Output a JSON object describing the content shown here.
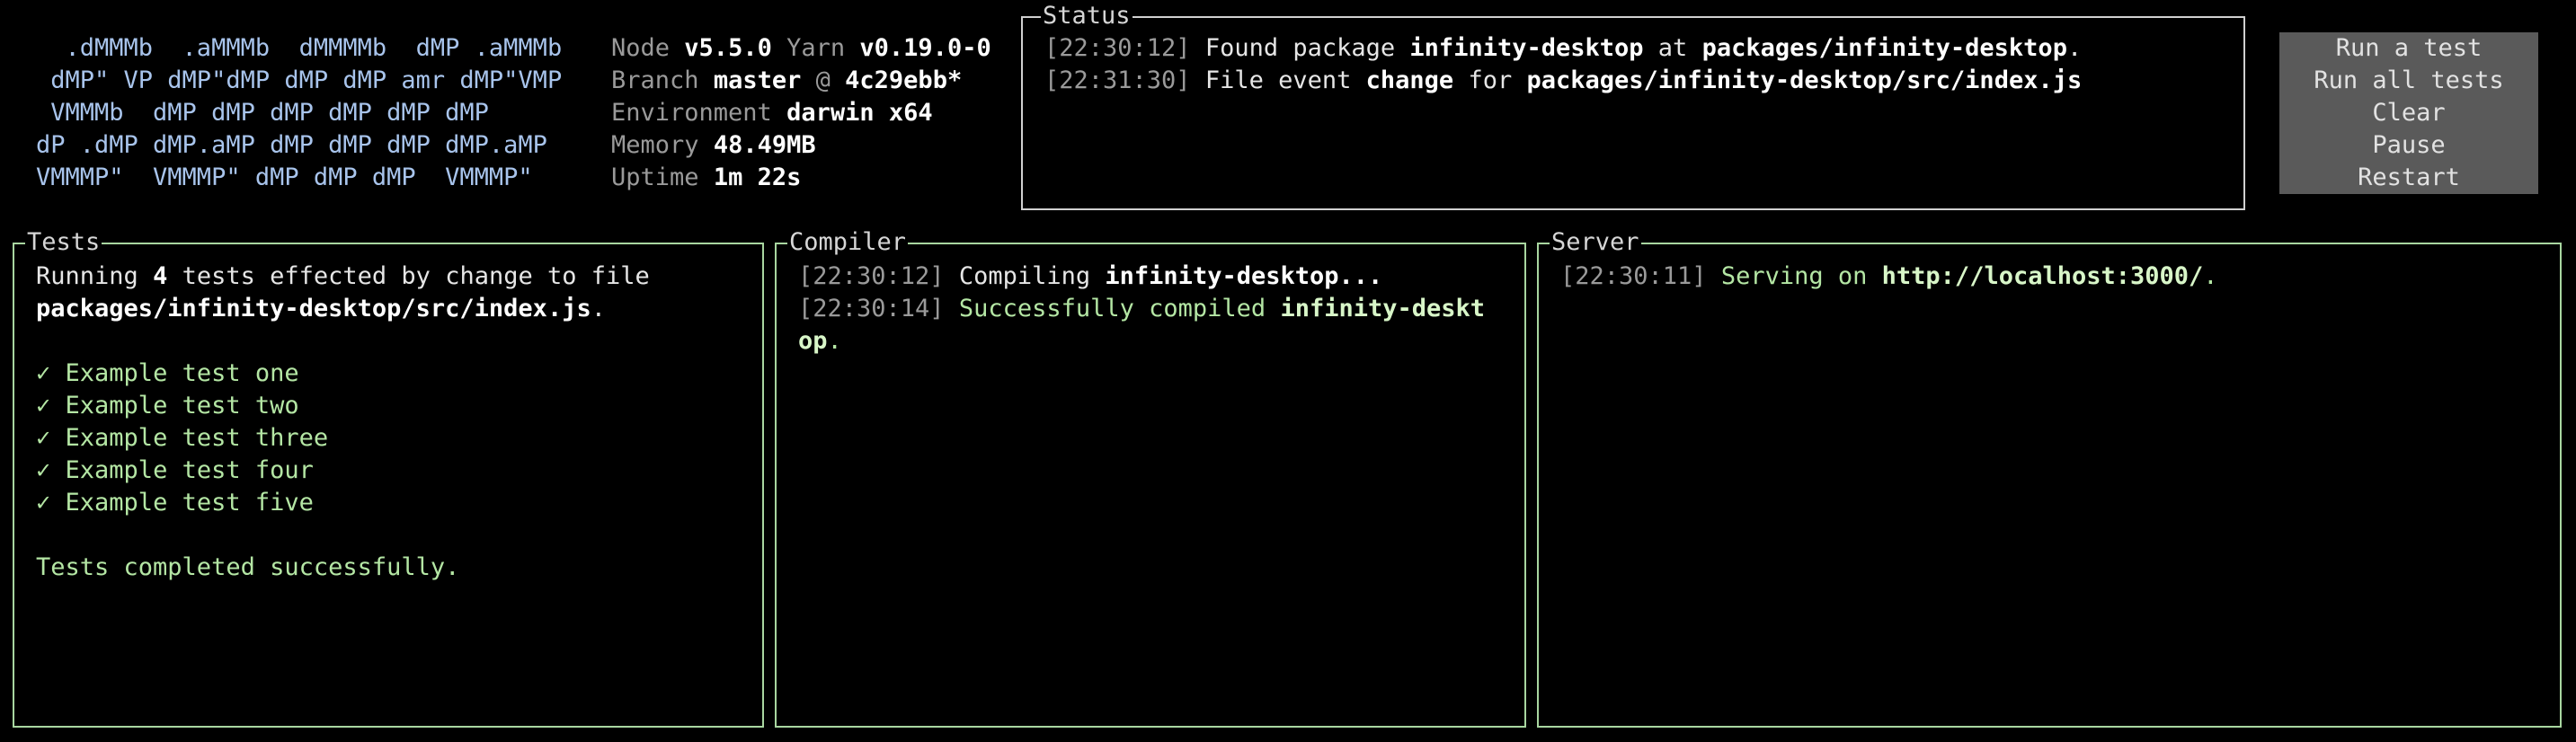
{
  "logo": {
    "lines": [
      "  .dMMMb  .aMMMb  dMMMMb  dMP .aMMMb",
      " dMP\" VP dMP\"dMP dMP dMP amr dMP\"VMP",
      " VMMMb  dMP dMP dMP dMP dMP dMP",
      "dP .dMP dMP.aMP dMP dMP dMP dMP.aMP",
      "VMMMP\"  VMMMP\" dMP dMP dMP  VMMMP\""
    ]
  },
  "info": {
    "node_label": "Node",
    "node_value": "v5.5.0",
    "yarn_label": "Yarn",
    "yarn_value": "v0.19.0-0",
    "branch_label": "Branch",
    "branch_value": "master",
    "branch_at": "@",
    "commit_value": "4c29ebb*",
    "env_label": "Environment",
    "env_value": "darwin x64",
    "memory_label": "Memory",
    "memory_value": "48.49MB",
    "uptime_label": "Uptime",
    "uptime_value": "1m 22s"
  },
  "status": {
    "title": "Status",
    "lines": [
      {
        "time": "[22:30:12]",
        "p1": "Found package",
        "b1": "infinity-desktop",
        "p2": "at",
        "b2": "packages/infinity-desktop",
        "p3": "."
      },
      {
        "time": "[22:31:30]",
        "p1": "File event",
        "b1": "change",
        "p2": "for",
        "b2": "packages/infinity-desktop/src/index.js",
        "p3": ""
      }
    ]
  },
  "menu": {
    "items": [
      "Run a test",
      "Run all tests",
      "Clear",
      "Pause",
      "Restart"
    ]
  },
  "tests": {
    "title": "Tests",
    "intro_1": "Running",
    "count": "4",
    "intro_2": "tests effected by change to file",
    "file": "packages/infinity-desktop/src/index.js",
    "file_suffix": ".",
    "check_mark": "✓",
    "results": [
      "Example test one",
      "Example test two",
      "Example test three",
      "Example test four",
      "Example test five"
    ],
    "summary": "Tests completed successfully."
  },
  "compiler": {
    "title": "Compiler",
    "line1_time": "[22:30:12]",
    "line1_text": "Compiling",
    "line1_bold": "infinity-desktop...",
    "line2_time": "[22:30:14]",
    "line2_text": "Successfully compiled",
    "line2_bold_a": "infinity-deskt",
    "line2_bold_b": "op",
    "line2_end": "."
  },
  "server": {
    "title": "Server",
    "time": "[22:30:11]",
    "text": "Serving on",
    "url": "http://localhost:3000/",
    "end": "."
  },
  "colors": {
    "background": "#000000",
    "logo": "#a8c4ec",
    "panel_border": "#a8d6a0",
    "success": "#b4e6a4",
    "menu_bg": "#5a5a5a"
  }
}
